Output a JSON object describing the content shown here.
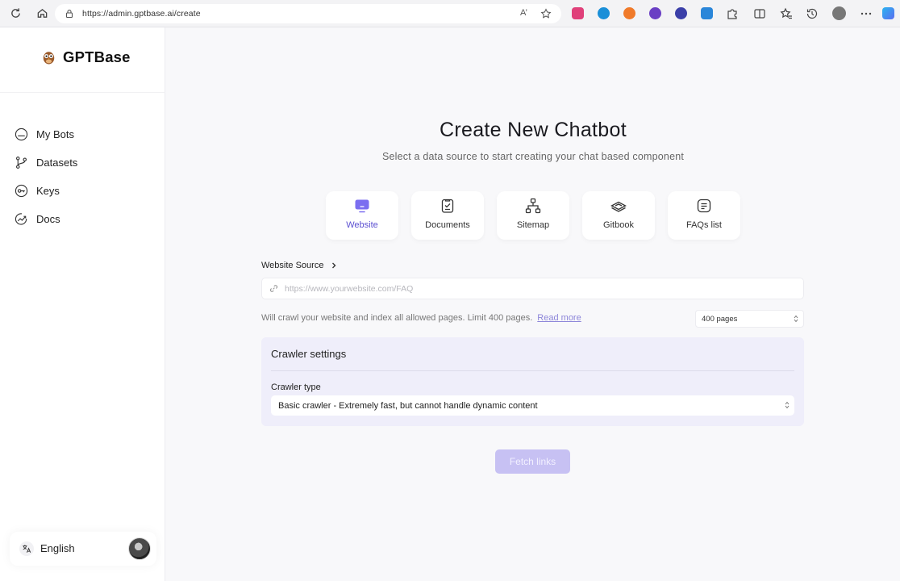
{
  "browser": {
    "url": "https://admin.gptbase.ai/create",
    "reader_label": "A’"
  },
  "sidebar": {
    "brand": "GPTBase",
    "items": [
      {
        "label": "My Bots",
        "icon": "bot-icon"
      },
      {
        "label": "Datasets",
        "icon": "branch-icon"
      },
      {
        "label": "Keys",
        "icon": "key-icon"
      },
      {
        "label": "Docs",
        "icon": "chart-icon"
      }
    ],
    "language": "English"
  },
  "main": {
    "title": "Create New Chatbot",
    "subtitle": "Select a data source to start creating your chat based component",
    "sources": [
      {
        "label": "Website",
        "icon": "monitor-icon",
        "active": true
      },
      {
        "label": "Documents",
        "icon": "clipboard-icon",
        "active": false
      },
      {
        "label": "Sitemap",
        "icon": "sitemap-icon",
        "active": false
      },
      {
        "label": "Gitbook",
        "icon": "book-icon",
        "active": false
      },
      {
        "label": "FAQs list",
        "icon": "faq-icon",
        "active": false
      }
    ],
    "website_source_label": "Website Source",
    "url_placeholder": "https://www.yourwebsite.com/FAQ",
    "crawl_note": "Will crawl your website and index all allowed pages. Limit 400 pages.",
    "read_more": "Read more",
    "pages_value": "400 pages",
    "crawler": {
      "title": "Crawler settings",
      "type_label": "Crawler type",
      "type_value": "Basic crawler - Extremely fast, but cannot handle dynamic content"
    },
    "fetch_button": "Fetch links"
  },
  "colors": {
    "accent": "#5b4fd1",
    "fetch_button_bg": "#c7c1f3",
    "crawler_bg": "#efeefa"
  }
}
